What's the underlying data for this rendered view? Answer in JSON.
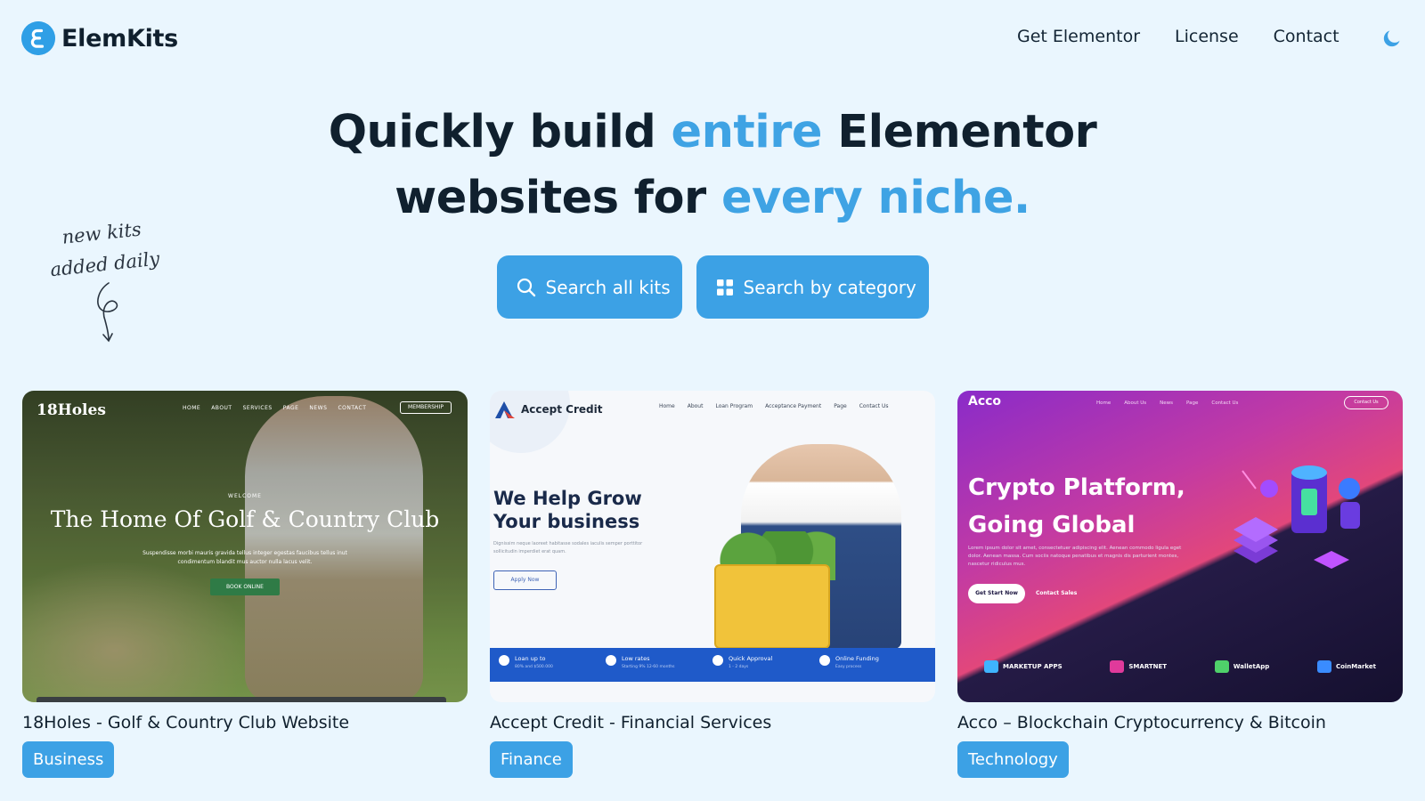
{
  "header": {
    "brand": "ElemKits",
    "nav": [
      "Get Elementor",
      "License",
      "Contact"
    ],
    "theme_toggle_icon": "moon-icon",
    "accent_color": "#3ca1e5"
  },
  "hero": {
    "line1_a": "Quickly build ",
    "line1_b": "entire",
    "line1_c": " Elementor",
    "line2_a": "websites for ",
    "line2_b": "every niche.",
    "search_all_label": "Search all kits",
    "search_category_label": "Search by category"
  },
  "note": {
    "line1": "new kits",
    "line2": "added daily"
  },
  "kits": [
    {
      "title": "18Holes - Golf & Country Club Website",
      "category": "Business",
      "preview": {
        "brand": "18Holes",
        "nav": [
          "HOME",
          "ABOUT",
          "SERVICES",
          "PAGE",
          "NEWS",
          "CONTACT"
        ],
        "cta_top": "MEMBERSHIP",
        "welcome": "WELCOME",
        "heading": "The Home Of Golf & Country Club",
        "subtext": "Suspendisse morbi mauris gravida tellus integer egestas faucibus tellus inut condimentum blandit mus auctor nulla lacus velit.",
        "button": "BOOK ONLINE"
      }
    },
    {
      "title": "Accept Credit - Financial Services",
      "category": "Finance",
      "preview": {
        "brand": "Accept Credit",
        "nav": [
          "Home",
          "About",
          "Loan Program",
          "Acceptance Payment",
          "Page",
          "Contact Us"
        ],
        "heading1": "We Help Grow",
        "heading2": "Your business",
        "subtext": "Dignissim neque laoreet habitasse sodales iaculis semper porttitor sollicitudin imperdiet erat quam.",
        "button": "Apply Now",
        "features": [
          {
            "label": "Loan up to",
            "sub": "80% and $500.000"
          },
          {
            "label": "Low rates",
            "sub": "Starting 9% 12-60 months"
          },
          {
            "label": "Quick Approval",
            "sub": "1 - 2 days"
          },
          {
            "label": "Online Funding",
            "sub": "Easy process"
          }
        ]
      }
    },
    {
      "title": "Acco – Blockchain Cryptocurrency & Bitcoin",
      "category": "Technology",
      "preview": {
        "brand": "Acco",
        "nav": [
          "Home",
          "About Us",
          "News",
          "Page",
          "Contact Us"
        ],
        "cta_top": "Contact Us",
        "heading1": "Crypto Platform,",
        "heading2": "Going Global",
        "subtext": "Lorem ipsum dolor sit amet, consectetuer adipiscing elit. Aenean commodo ligula eget dolor. Aenean massa. Cum sociis natoque penatibus et magnis dis parturient montes, nascetur ridiculus mus.",
        "button": "Get Start Now",
        "link": "Contact Sales",
        "partners": [
          "MARKETUP APPS",
          "SMARTNET",
          "WalletApp",
          "CoinMarket"
        ]
      }
    }
  ]
}
